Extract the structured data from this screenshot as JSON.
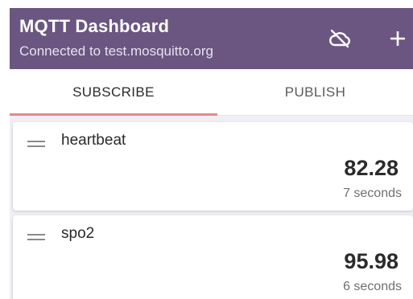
{
  "app_bar": {
    "title": "MQTT Dashboard",
    "subtitle": "Connected to test.mosquitto.org",
    "actions": [
      {
        "icon": "cloud-off-icon"
      },
      {
        "icon": "add-icon"
      }
    ],
    "background_color": "#6a5680"
  },
  "tabs": [
    {
      "label": "SUBSCRIBE",
      "selected": true
    },
    {
      "label": "PUBLISH",
      "selected": false
    }
  ],
  "tab_indicator_color": "#e08a8a",
  "subscriptions": [
    {
      "topic": "heartbeat",
      "value": "82.28",
      "age": "7 seconds"
    },
    {
      "topic": "spo2",
      "value": "95.98",
      "age": "6 seconds"
    }
  ]
}
